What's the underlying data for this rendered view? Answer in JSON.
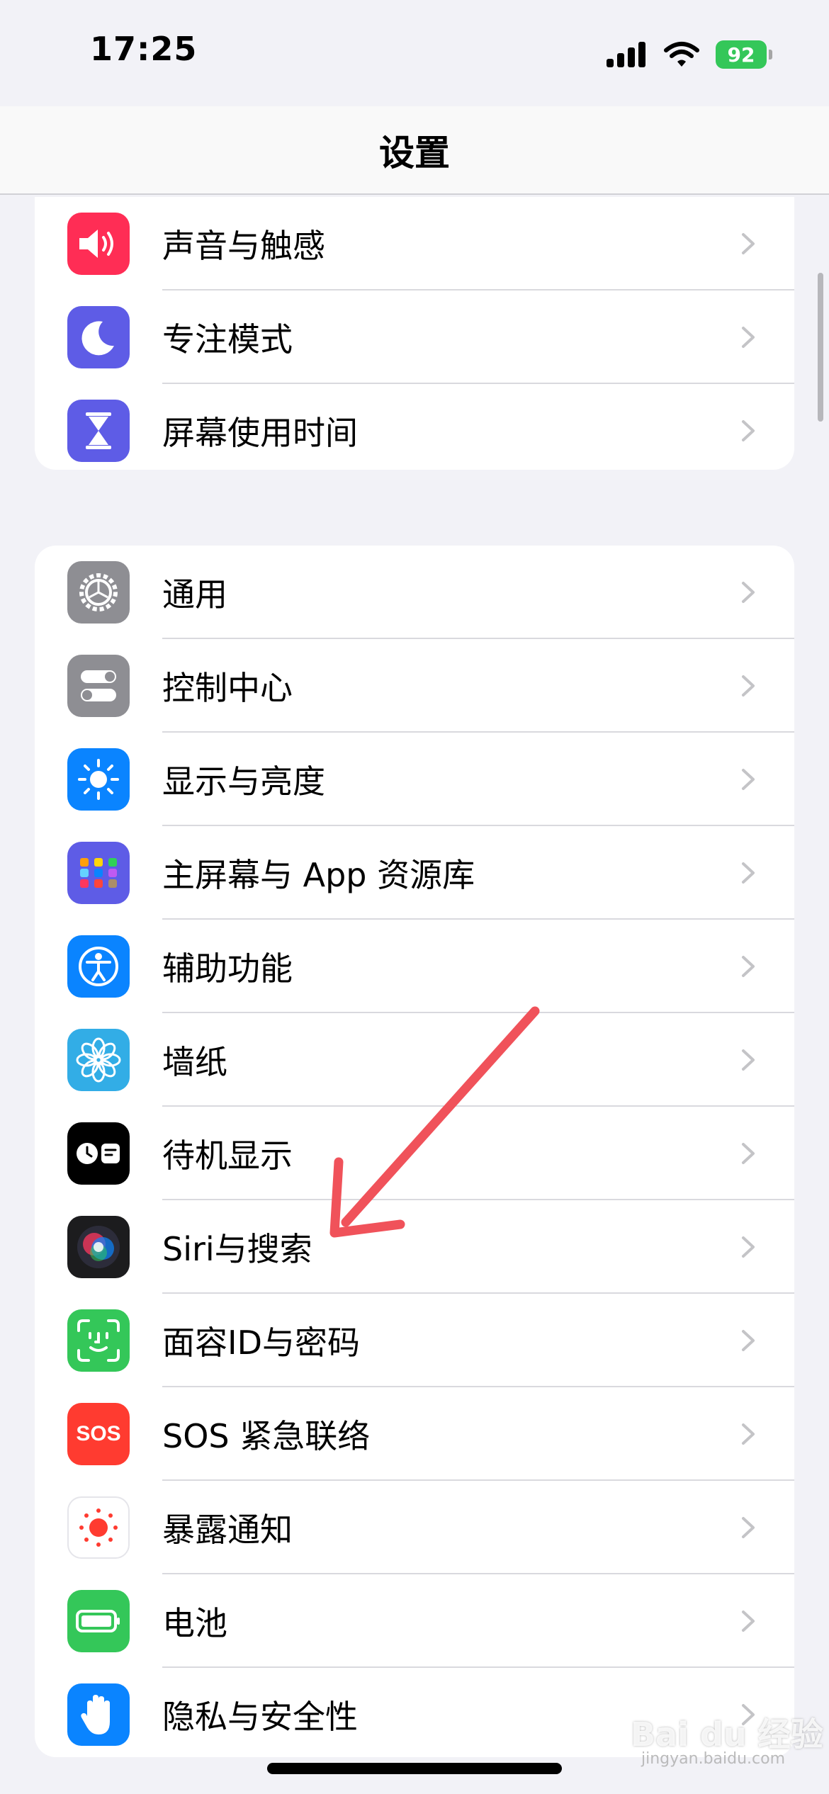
{
  "status": {
    "time": "17:25",
    "battery": "92"
  },
  "nav": {
    "title": "设置"
  },
  "group1": [
    {
      "label": "声音与触感",
      "icon": "speaker-icon",
      "color": "#ff2d55"
    },
    {
      "label": "专注模式",
      "icon": "moon-icon",
      "color": "#5e5ce6"
    },
    {
      "label": "屏幕使用时间",
      "icon": "hourglass-icon",
      "color": "#5e5ce6"
    }
  ],
  "group2": [
    {
      "label": "通用",
      "icon": "gear-icon",
      "color": "#8e8e93"
    },
    {
      "label": "控制中心",
      "icon": "toggles-icon",
      "color": "#8e8e93"
    },
    {
      "label": "显示与亮度",
      "icon": "sun-icon",
      "color": "#0a84ff"
    },
    {
      "label": "主屏幕与 App 资源库",
      "icon": "app-grid-icon",
      "color": "#5e5ce6"
    },
    {
      "label": "辅助功能",
      "icon": "accessibility-icon",
      "color": "#0a84ff"
    },
    {
      "label": "墙纸",
      "icon": "flower-icon",
      "color": "#32ade6"
    },
    {
      "label": "待机显示",
      "icon": "standby-icon",
      "color": "#000000"
    },
    {
      "label": "Siri与搜索",
      "icon": "siri-icon",
      "color": "#1c1c1e"
    },
    {
      "label": "面容ID与密码",
      "icon": "face-id-icon",
      "color": "#34c759"
    },
    {
      "label": "SOS 紧急联络",
      "icon": "sos-icon",
      "color": "#ff3b30",
      "icon_text": "SOS"
    },
    {
      "label": "暴露通知",
      "icon": "exposure-icon",
      "color": "#ffffff"
    },
    {
      "label": "电池",
      "icon": "battery-icon",
      "color": "#34c759"
    },
    {
      "label": "隐私与安全性",
      "icon": "hand-icon",
      "color": "#0a84ff"
    }
  ],
  "watermark": {
    "main": "Bai du 经验",
    "sub": "jingyan.baidu.com"
  }
}
